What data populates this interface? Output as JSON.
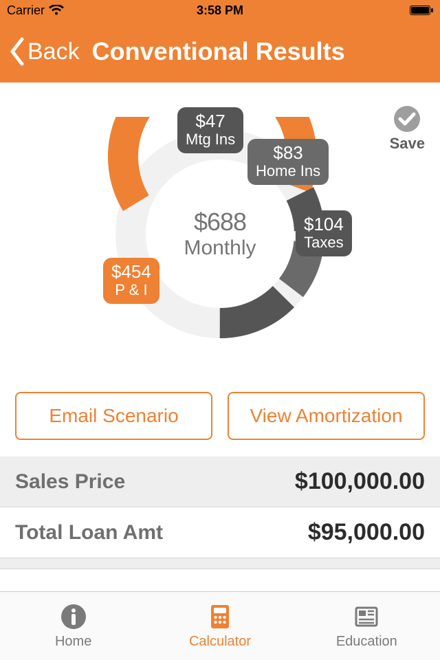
{
  "status": {
    "carrier": "Carrier",
    "time": "3:58 PM"
  },
  "nav": {
    "back": "Back",
    "title": "Conventional Results"
  },
  "save": {
    "label": "Save"
  },
  "chart_data": {
    "type": "pie",
    "title": "$688 Monthly",
    "series": [
      {
        "name": "P & I",
        "value": 454,
        "color": "#ee8133"
      },
      {
        "name": "Mtg Ins",
        "value": 47,
        "color": "#555555"
      },
      {
        "name": "Home Ins",
        "value": 83,
        "color": "#6a6a6a"
      },
      {
        "name": "Taxes",
        "value": 104,
        "color": "#555555"
      }
    ],
    "total": 688,
    "period": "Monthly"
  },
  "center": {
    "amount": "$688",
    "period": "Monthly"
  },
  "bubbles": {
    "pi": {
      "amount": "$454",
      "label": "P & I"
    },
    "mtg": {
      "amount": "$47",
      "label": "Mtg Ins"
    },
    "home": {
      "amount": "$83",
      "label": "Home Ins"
    },
    "taxes": {
      "amount": "$104",
      "label": "Taxes"
    }
  },
  "actions": {
    "email": "Email Scenario",
    "amort": "View Amortization"
  },
  "rows": {
    "salesPrice": {
      "label": "Sales Price",
      "value": "$100,000.00"
    },
    "totalLoanAmt": {
      "label": "Total Loan Amt",
      "value": "$95,000.00"
    }
  },
  "tabs": {
    "home": "Home",
    "calculator": "Calculator",
    "education": "Education"
  },
  "colors": {
    "accent": "#ee8133",
    "bubbleDark": "#555555"
  }
}
